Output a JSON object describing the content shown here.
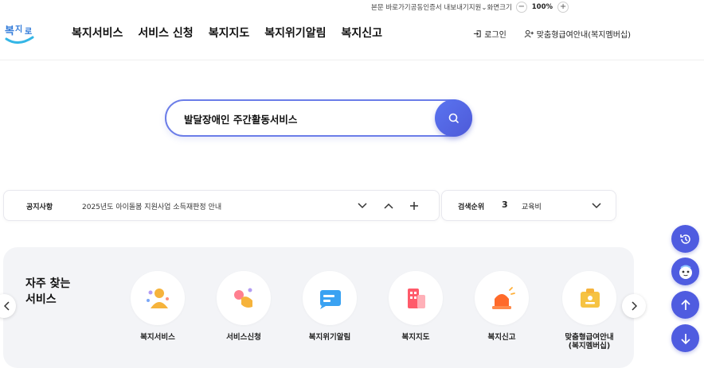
{
  "utility": {
    "skip_link": "본문 바로가기",
    "cert_export": "공동인증서 내보내기",
    "support": "지원",
    "screen_size": "화면크기",
    "zoom_value": "100%",
    "zoom_out": "−",
    "zoom_in": "+"
  },
  "logo": {
    "text": "복지로"
  },
  "nav": {
    "items": [
      "복지서비스",
      "서비스 신청",
      "복지지도",
      "복지위기알림",
      "복지신고"
    ]
  },
  "header_right": {
    "login": "로그인",
    "membership": "맞춤형급여안내(복지멤버십)"
  },
  "search": {
    "value": "발달장애인 주간활동서비스",
    "icon": "search-icon"
  },
  "notice": {
    "label": "공지사항",
    "text": "2025년도 아이돌봄 지원사업 소득재판정 안내"
  },
  "ranking": {
    "label": "검색순위",
    "rank": "3",
    "keyword": "교육비"
  },
  "frequent": {
    "title_line1": "자주 찾는",
    "title_line2": "서비스",
    "services": [
      {
        "label": "복지서비스"
      },
      {
        "label": "서비스신청"
      },
      {
        "label": "복지위기알림"
      },
      {
        "label": "복지지도"
      },
      {
        "label": "복지신고"
      },
      {
        "label": "맞춤형급여안내\n(복지멤버십)"
      }
    ]
  },
  "colors": {
    "accent": "#4f5ce0",
    "search_border": "#6b7de8",
    "panel_bg": "#f3f4f7"
  }
}
